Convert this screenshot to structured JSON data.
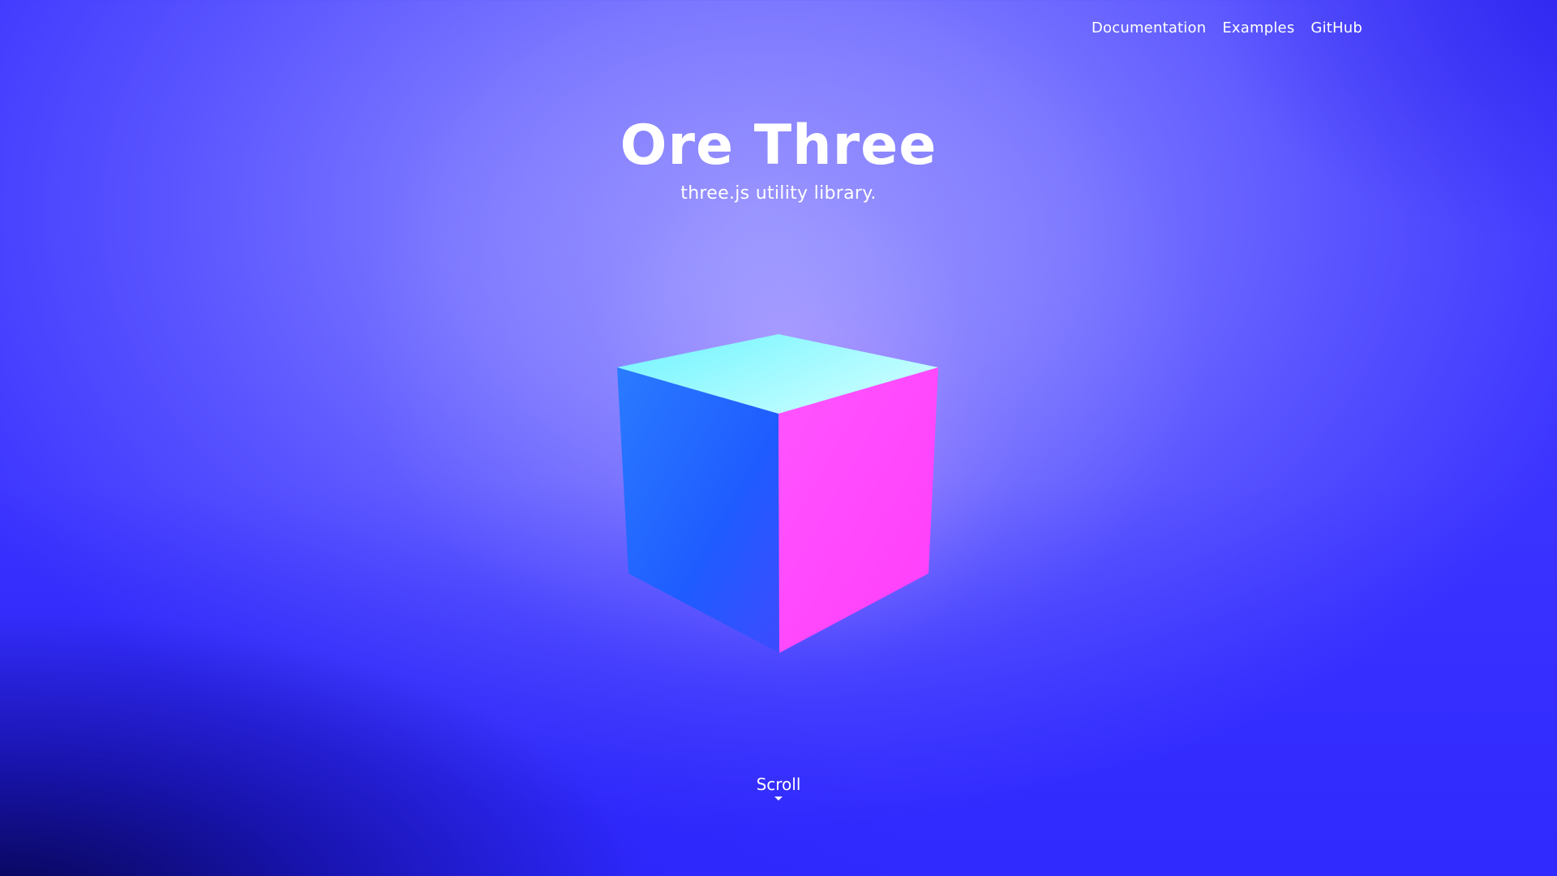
{
  "nav": {
    "items": [
      {
        "label": "Documentation"
      },
      {
        "label": "Examples"
      },
      {
        "label": "GitHub"
      }
    ]
  },
  "hero": {
    "title": "Ore Three",
    "subtitle": "three.js utility library."
  },
  "scroll": {
    "label": "Scroll",
    "icon": "caret-down-icon"
  },
  "colors": {
    "background": "#6b66ff",
    "cube_top": "#8ff6ff",
    "cube_left": "#1f63ff",
    "cube_right": "#ff4dff"
  }
}
